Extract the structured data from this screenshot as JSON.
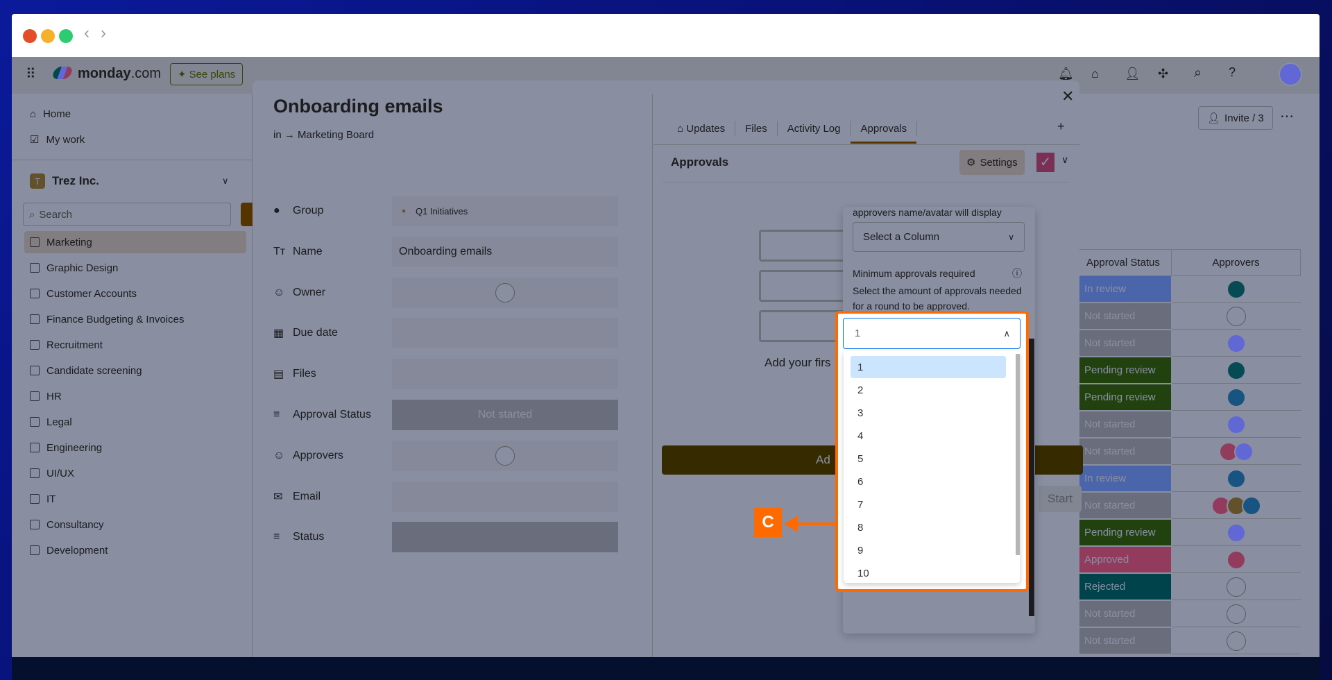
{
  "browser": {
    "dots": [
      "#e44d26",
      "#f5b12c",
      "#2ecc71"
    ]
  },
  "topnav": {
    "brand": "monday",
    "brand_suffix": ".com",
    "see_plans": "See plans"
  },
  "sidebar": {
    "home": "Home",
    "my_work": "My work",
    "workspace_initial": "T",
    "workspace": "Trez Inc.",
    "search_placeholder": "Search",
    "boards": [
      "Marketing",
      "Graphic Design",
      "Customer Accounts",
      "Finance Budgeting & Invoices",
      "Recruitment",
      "Candidate screening",
      "HR",
      "Legal",
      "Engineering",
      "UI/UX",
      "IT",
      "Consultancy",
      "Development"
    ]
  },
  "board": {
    "invite": "Invite / 3",
    "columns": [
      "Approval Status",
      "Approvers"
    ],
    "rows": [
      {
        "status": "In review",
        "color": "#fdab3d",
        "approvers": [
          "#e2445c"
        ]
      },
      {
        "status": "Not started",
        "color": "#c4c4c4",
        "approvers": []
      },
      {
        "status": "Not started",
        "color": "#c4c4c4",
        "approvers": [
          "#ffcb00"
        ]
      },
      {
        "status": "Pending review",
        "color": "#784bd1",
        "approvers": [
          "#e2445c"
        ]
      },
      {
        "status": "Pending review",
        "color": "#784bd1",
        "approvers": [
          "#ff642e"
        ]
      },
      {
        "status": "Not started",
        "color": "#c4c4c4",
        "approvers": [
          "#ffcb00"
        ]
      },
      {
        "status": "Not started",
        "color": "#c4c4c4",
        "approvers": [
          "#00c875",
          "#ffcb00"
        ]
      },
      {
        "status": "In review",
        "color": "#fdab3d",
        "approvers": [
          "#ff642e"
        ]
      },
      {
        "status": "Not started",
        "color": "#c4c4c4",
        "approvers": [
          "#00c875",
          "#579bfc",
          "#ff642e"
        ]
      },
      {
        "status": "Pending review",
        "color": "#784bd1",
        "approvers": [
          "#ffcb00"
        ]
      },
      {
        "status": "Approved",
        "color": "#00c875",
        "approvers": [
          "#00c875"
        ]
      },
      {
        "status": "Rejected",
        "color": "#df2f4a",
        "approvers": []
      },
      {
        "status": "Not started",
        "color": "#c4c4c4",
        "approvers": []
      },
      {
        "status": "Not started",
        "color": "#c4c4c4",
        "approvers": []
      }
    ]
  },
  "item": {
    "title": "Onboarding emails",
    "breadcrumb_prefix": "in →",
    "breadcrumb": "Marketing Board",
    "fields": [
      {
        "label": "Group",
        "value": "Q1 Initiatives",
        "icon": "circle-icon"
      },
      {
        "label": "Name",
        "value": "Onboarding emails",
        "icon": "text-icon"
      },
      {
        "label": "Owner",
        "value": "",
        "icon": "people-icon"
      },
      {
        "label": "Due date",
        "value": "",
        "icon": "calendar-icon"
      },
      {
        "label": "Files",
        "value": "",
        "icon": "file-icon"
      },
      {
        "label": "Approval Status",
        "value": "Not started",
        "icon": "status-icon"
      },
      {
        "label": "Approvers",
        "value": "",
        "icon": "people-icon"
      },
      {
        "label": "Email",
        "value": "",
        "icon": "email-icon"
      },
      {
        "label": "Status",
        "value": "",
        "icon": "status-icon"
      }
    ]
  },
  "tabs": [
    "Updates",
    "Files",
    "Activity Log",
    "Approvals"
  ],
  "active_tab": "Approvals",
  "approvals": {
    "heading": "Approvals",
    "settings": "Settings",
    "empty_text": "Add your firs",
    "add_button": "Ad",
    "start_button": "Start"
  },
  "settings_panel": {
    "top_text": "approvers name/avatar will display",
    "column_select": "Select a Column",
    "min_label": "Minimum approvals required",
    "min_desc": "Select the amount of approvals needed for a round to be approved.",
    "min_value": "1",
    "options": [
      "1",
      "2",
      "3",
      "4",
      "5",
      "6",
      "7",
      "8",
      "9",
      "10"
    ],
    "selected_option": "1"
  },
  "callout": {
    "label": "C",
    "color": "#ff6a00"
  }
}
